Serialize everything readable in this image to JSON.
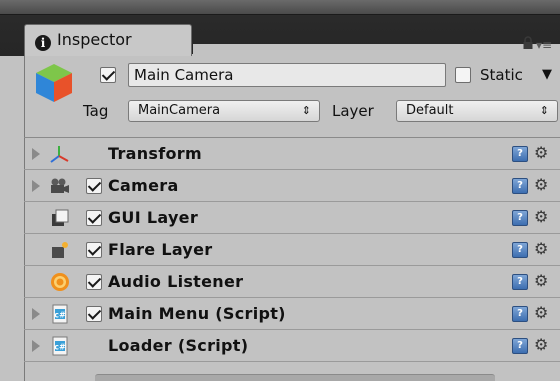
{
  "tab": {
    "title": "Inspector",
    "icon": "info-icon"
  },
  "toolbar": {
    "lock_icon": "lock-icon",
    "menu_icon": "panel-menu-icon"
  },
  "gameobject": {
    "icon": "gameobject-cube-icon",
    "active": true,
    "name": "Main Camera",
    "static_label": "Static",
    "static_checked": false,
    "tag_label": "Tag",
    "tag_value": "MainCamera",
    "layer_label": "Layer",
    "layer_value": "Default"
  },
  "components": [
    {
      "label": "Transform",
      "icon": "transform-axes-icon",
      "has_foldout": true,
      "has_checkbox": false
    },
    {
      "label": "Camera",
      "icon": "camera-icon",
      "has_foldout": true,
      "has_checkbox": true,
      "enabled": true
    },
    {
      "label": "GUI Layer",
      "icon": "gui-layer-icon",
      "has_foldout": false,
      "has_checkbox": true,
      "enabled": true
    },
    {
      "label": "Flare Layer",
      "icon": "flare-layer-icon",
      "has_foldout": false,
      "has_checkbox": true,
      "enabled": true
    },
    {
      "label": "Audio Listener",
      "icon": "audio-listener-icon",
      "has_foldout": false,
      "has_checkbox": true,
      "enabled": true
    },
    {
      "label": "Main Menu (Script)",
      "icon": "csharp-script-icon",
      "has_foldout": true,
      "has_checkbox": true,
      "enabled": true
    },
    {
      "label": "Loader (Script)",
      "icon": "csharp-script-icon",
      "has_foldout": true,
      "has_checkbox": false
    }
  ],
  "colors": {
    "panel_bg": "#c2c2c2",
    "tab_strip": "#2a2a2a",
    "help_blue": "#3d6eb0",
    "audio_orange": "#f0901c"
  }
}
